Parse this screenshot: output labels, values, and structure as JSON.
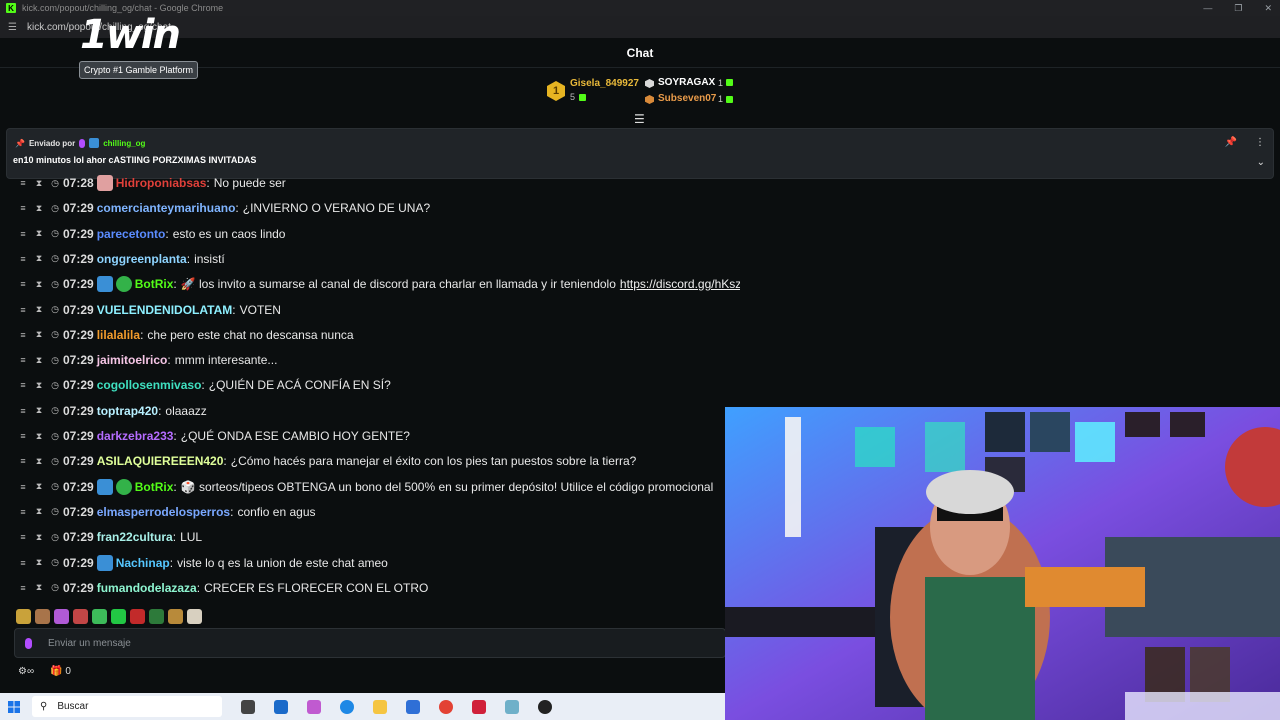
{
  "window": {
    "title": "kick.com/popout/chilling_og/chat - Google Chrome",
    "url": "kick.com/popout/chilling_og/chat"
  },
  "overlay": {
    "logo": "1win",
    "tagline": "Crypto #1 Gamble Platform"
  },
  "header": {
    "title": "Chat"
  },
  "leaderboard": {
    "top": {
      "rank": "1",
      "name": "Gisela_849927",
      "count": "5"
    },
    "second": {
      "name": "SOYRAGAX",
      "count": "1"
    },
    "third": {
      "name": "Subseven07",
      "count": "1"
    }
  },
  "pinned": {
    "sent_by_label": "Enviado por",
    "user": "chilling_og",
    "text": "en10 minutos lol ahor cASTIING PORZXIMAS INVITADAS"
  },
  "messages": [
    {
      "time": "07:28",
      "user": "Hidroponiabsas",
      "color": "#e0403a",
      "text": "No puede ser",
      "badges": [
        "sub"
      ]
    },
    {
      "time": "07:29",
      "user": "comercianteymarihuano",
      "color": "#7fb4ff",
      "text": "¿INVIERNO O VERANO DE UNA?",
      "badges": []
    },
    {
      "time": "07:29",
      "user": "parecetonto",
      "color": "#5b8cff",
      "text": "esto es un caos lindo",
      "badges": []
    },
    {
      "time": "07:29",
      "user": "onggreenplanta",
      "color": "#8ed4ff",
      "text": "insistí",
      "badges": []
    },
    {
      "time": "07:29",
      "user": "BotRix",
      "color": "#53fc18",
      "text": "🚀 los invito a sumarse al canal de discord para charlar en llamada y ir teniendolo",
      "link": "https://discord.gg/hKszR7Hgup",
      "badges": [
        "bot",
        "verified"
      ]
    },
    {
      "time": "07:29",
      "user": "VUELENDENIDOLATAM",
      "color": "#8ef0ff",
      "text": "VOTEN",
      "badges": []
    },
    {
      "time": "07:29",
      "user": "lilalalila",
      "color": "#f39c2c",
      "text": "che pero este chat no descansa nunca",
      "badges": []
    },
    {
      "time": "07:29",
      "user": "jaimitoelrico",
      "color": "#f6c6e6",
      "text": "mmm interesante...",
      "badges": []
    },
    {
      "time": "07:29",
      "user": "cogollosenmivaso",
      "color": "#3fe0c0",
      "text": "¿QUIÉN DE ACÁ CONFÍA EN SÍ?",
      "badges": []
    },
    {
      "time": "07:29",
      "user": "toptrap420",
      "color": "#b8f0ff",
      "text": "olaaazz",
      "badges": []
    },
    {
      "time": "07:29",
      "user": "darkzebra233",
      "color": "#b56cff",
      "text": "¿QUÉ ONDA ESE CAMBIO HOY GENTE?",
      "badges": []
    },
    {
      "time": "07:29",
      "user": "ASILAQUIEREEEN420",
      "color": "#e0ff9a",
      "text": "¿Cómo hacés para manejar el éxito con los pies tan puestos sobre la tierra?",
      "badges": []
    },
    {
      "time": "07:29",
      "user": "BotRix",
      "color": "#53fc18",
      "text": "🎲 sorteos/tipeos OBTENGA un bono del 500% en su primer depósito! Utilice el código promocional",
      "badges": [
        "bot",
        "verified"
      ]
    },
    {
      "time": "07:29",
      "user": "elmasperrodelosperros",
      "color": "#7aa8ff",
      "text": "confio en agus",
      "badges": []
    },
    {
      "time": "07:29",
      "user": "fran22cultura",
      "color": "#a8f0e8",
      "text": "LUL",
      "badges": []
    },
    {
      "time": "07:29",
      "user": "Nachinap",
      "color": "#56c7ff",
      "text": "viste lo q es la union de este chat ameo",
      "badges": [
        "bot"
      ]
    },
    {
      "time": "07:29",
      "user": "fumandodelazaza",
      "color": "#8ef5d0",
      "text": "CRECER ES FLORECER CON EL OTRO",
      "badges": []
    }
  ],
  "composer": {
    "placeholder": "Enviar un mensaje"
  },
  "footer": {
    "count": "0"
  },
  "taskbar": {
    "search": "Buscar"
  },
  "colors": {
    "kick_green": "#53fc18",
    "bg": "#0b0e0f"
  }
}
